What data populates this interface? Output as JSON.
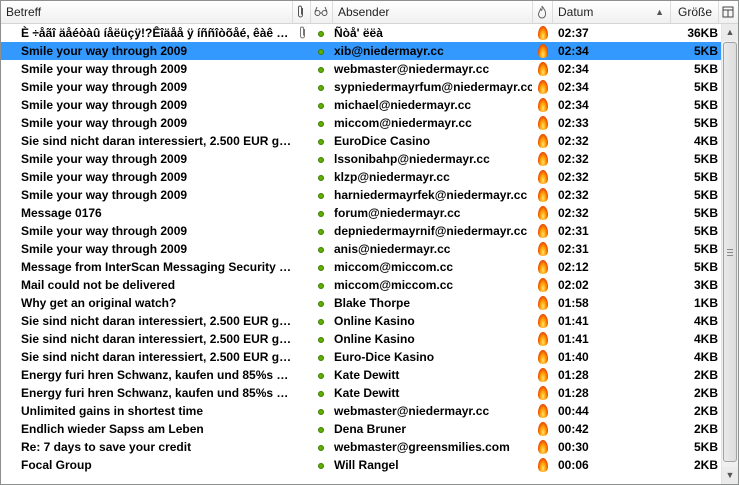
{
  "columns": {
    "subject": "Betreff",
    "attachment_icon": "paperclip-icon",
    "read_icon": "glasses-icon",
    "sender": "Absender",
    "junk_icon": "flame-icon",
    "date": "Datum",
    "date_sort": "▲",
    "size": "Größe",
    "picker_icon": "column-picker-icon"
  },
  "colors": {
    "selected_row": "#3399ff",
    "read_dot": "#5fb000"
  },
  "messages": [
    {
      "subject": "È ÷åãî äåéòàû íåëüçÿ!?Êîäåå ÿ íññîòõåé, êàê ôèðì",
      "attach": true,
      "sender": "Ñòå' ëëà",
      "date": "02:37",
      "size": "36KB",
      "selected": false
    },
    {
      "subject": "Smile your way through 2009",
      "attach": false,
      "sender": "xib@niedermayr.cc",
      "date": "02:34",
      "size": "5KB",
      "selected": true
    },
    {
      "subject": "Smile your way through 2009",
      "attach": false,
      "sender": "webmaster@niedermayr.cc",
      "date": "02:34",
      "size": "5KB",
      "selected": false
    },
    {
      "subject": "Smile your way through 2009",
      "attach": false,
      "sender": "sypniedermayrfum@niedermayr.cc",
      "date": "02:34",
      "size": "5KB",
      "selected": false
    },
    {
      "subject": "Smile your way through 2009",
      "attach": false,
      "sender": "michael@niedermayr.cc",
      "date": "02:34",
      "size": "5KB",
      "selected": false
    },
    {
      "subject": "Smile your way through 2009",
      "attach": false,
      "sender": "miccom@niedermayr.cc",
      "date": "02:33",
      "size": "5KB",
      "selected": false
    },
    {
      "subject": "Sie sind nicht daran interessiert, 2.500 EUR gan...",
      "attach": false,
      "sender": "EuroDice Casino",
      "date": "02:32",
      "size": "4KB",
      "selected": false
    },
    {
      "subject": "Smile your way through 2009",
      "attach": false,
      "sender": "lssonibahp@niedermayr.cc",
      "date": "02:32",
      "size": "5KB",
      "selected": false
    },
    {
      "subject": "Smile your way through 2009",
      "attach": false,
      "sender": "klzp@niedermayr.cc",
      "date": "02:32",
      "size": "5KB",
      "selected": false
    },
    {
      "subject": "Smile your way through 2009",
      "attach": false,
      "sender": "harniedermayrfek@niedermayr.cc",
      "date": "02:32",
      "size": "5KB",
      "selected": false
    },
    {
      "subject": "Message 0176",
      "attach": false,
      "sender": "forum@niedermayr.cc",
      "date": "02:32",
      "size": "5KB",
      "selected": false
    },
    {
      "subject": "Smile your way through 2009",
      "attach": false,
      "sender": "depniedermayrnif@niedermayr.cc",
      "date": "02:31",
      "size": "5KB",
      "selected": false
    },
    {
      "subject": "Smile your way through 2009",
      "attach": false,
      "sender": "anis@niedermayr.cc",
      "date": "02:31",
      "size": "5KB",
      "selected": false
    },
    {
      "subject": "Message from InterScan Messaging Security S...",
      "attach": false,
      "sender": "miccom@miccom.cc",
      "date": "02:12",
      "size": "5KB",
      "selected": false
    },
    {
      "subject": "Mail could not be delivered",
      "attach": false,
      "sender": "miccom@miccom.cc",
      "date": "02:02",
      "size": "3KB",
      "selected": false
    },
    {
      "subject": "Why get an original watch?",
      "attach": false,
      "sender": "Blake Thorpe",
      "date": "01:58",
      "size": "1KB",
      "selected": false
    },
    {
      "subject": "Sie sind nicht daran interessiert, 2.500 EUR gan...",
      "attach": false,
      "sender": "Online Kasino",
      "date": "01:41",
      "size": "4KB",
      "selected": false
    },
    {
      "subject": "Sie sind nicht daran interessiert, 2.500 EUR gan...",
      "attach": false,
      "sender": "Online Kasino",
      "date": "01:41",
      "size": "4KB",
      "selected": false
    },
    {
      "subject": "Sie sind nicht daran interessiert, 2.500 EUR gan...",
      "attach": false,
      "sender": "Euro-Dice Kasino",
      "date": "01:40",
      "size": "4KB",
      "selected": false
    },
    {
      "subject": "Energy furi hren Schwanz, kaufen und 85%s pa...",
      "attach": false,
      "sender": "Kate Dewitt",
      "date": "01:28",
      "size": "2KB",
      "selected": false
    },
    {
      "subject": "Energy furi hren Schwanz, kaufen und 85%s pa...",
      "attach": false,
      "sender": "Kate Dewitt",
      "date": "01:28",
      "size": "2KB",
      "selected": false
    },
    {
      "subject": "Unlimited gains in shortest time",
      "attach": false,
      "sender": "webmaster@niedermayr.cc",
      "date": "00:44",
      "size": "2KB",
      "selected": false
    },
    {
      "subject": "Endlich wieder Sapss am Leben",
      "attach": false,
      "sender": "Dena Bruner",
      "date": "00:42",
      "size": "2KB",
      "selected": false
    },
    {
      "subject": "Re: 7 days to save your credit",
      "attach": false,
      "sender": "webmaster@greensmilies.com",
      "date": "00:30",
      "size": "5KB",
      "selected": false
    },
    {
      "subject": "Focal Group",
      "attach": false,
      "sender": "Will Rangel",
      "date": "00:06",
      "size": "2KB",
      "selected": false
    }
  ]
}
